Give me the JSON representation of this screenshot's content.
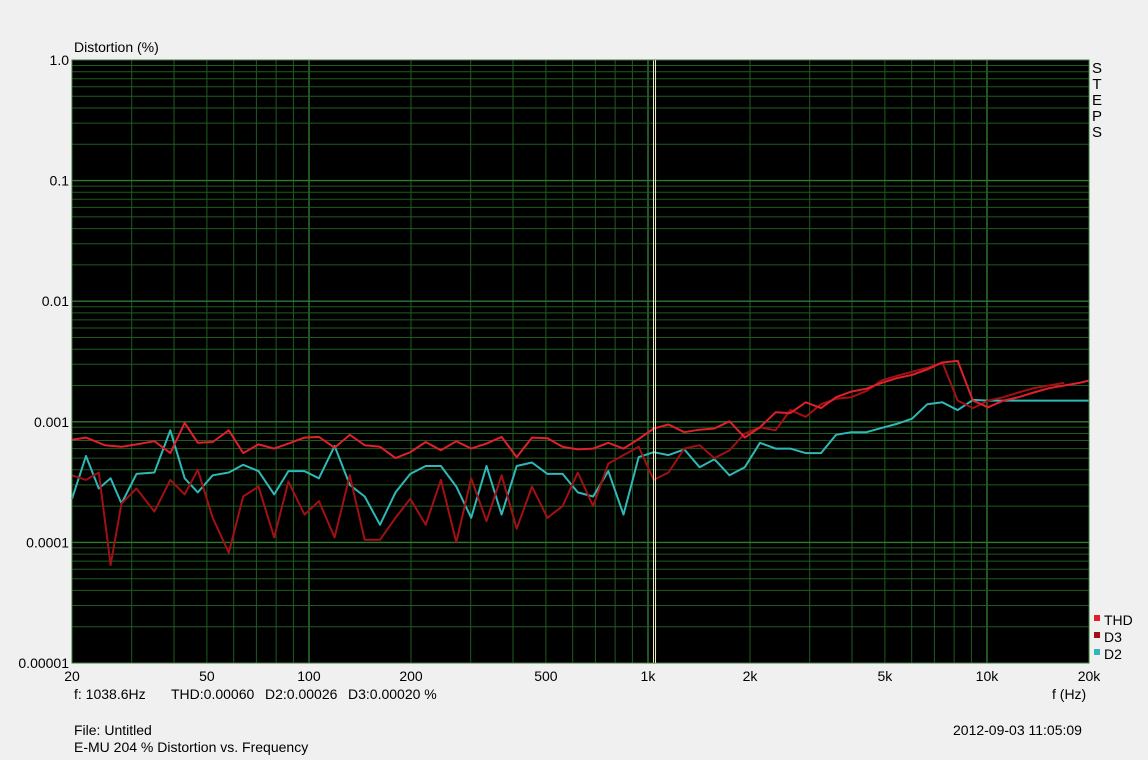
{
  "window": {
    "title": "E-MU 204 % Distortion vs. Frequency"
  },
  "footer": {
    "file_label": "File: Untitled",
    "title": "E-MU 204 % Distortion vs. Frequency",
    "timestamp": "2012-09-03 11:05:09"
  },
  "readout": {
    "freq": "f: 1038.6Hz",
    "thd": "THD:0.00060",
    "d2": "D2:0.00026",
    "d3": "D3:0.00020 %"
  },
  "side_button": {
    "label": "STEPS",
    "letters": [
      "S",
      "T",
      "E",
      "P",
      "S"
    ]
  },
  "colors": {
    "background": "#000000",
    "grid": "#1f5c1f",
    "cursor": "#f0f0c0",
    "thd": "#e0202a",
    "d3": "#a01014",
    "d2": "#2fb8b8"
  },
  "chart_data": {
    "type": "line",
    "title": "",
    "ylabel": "Distortion (%)",
    "xlabel": "f (Hz)",
    "xscale": "log",
    "yscale": "log",
    "xlim": [
      20,
      20000
    ],
    "ylim": [
      1e-05,
      1.0
    ],
    "grid": true,
    "legend_position": "bottom-right",
    "x_tick_labels": [
      "20",
      "50",
      "100",
      "200",
      "500",
      "1k",
      "2k",
      "5k",
      "10k",
      "20k"
    ],
    "x_tick_values": [
      20,
      50,
      100,
      200,
      500,
      1000,
      2000,
      5000,
      10000,
      20000
    ],
    "y_tick_labels": [
      "1.0",
      "0.1",
      "0.01",
      "0.001",
      "0.0001",
      "0.00001"
    ],
    "y_tick_values": [
      1.0,
      0.1,
      0.01,
      0.001,
      0.0001,
      1e-05
    ],
    "cursor_x": 1038.6,
    "series": [
      {
        "name": "THD",
        "color": "#e0202a",
        "x": [
          20,
          22,
          25,
          28,
          31,
          35,
          39,
          43,
          47,
          52,
          58,
          64,
          71,
          79,
          87,
          97,
          107,
          119,
          132,
          146,
          162,
          180,
          199,
          221,
          245,
          272,
          301,
          334,
          370,
          410,
          455,
          505,
          560,
          621,
          689,
          764,
          847,
          939,
          1040,
          1150,
          1280,
          1420,
          1570,
          1740,
          1930,
          2140,
          2380,
          2630,
          2920,
          3240,
          3590,
          3980,
          4410,
          4890,
          5420,
          6010,
          6670,
          7390,
          8200,
          9090,
          10080,
          11180,
          12390,
          13740,
          15240,
          16900,
          18740,
          20000
        ],
        "y": [
          0.00071,
          0.00074,
          0.00064,
          0.00062,
          0.00065,
          0.00069,
          0.00055,
          0.00098,
          0.00067,
          0.00068,
          0.00085,
          0.00055,
          0.00065,
          0.0006,
          0.00066,
          0.00074,
          0.00075,
          0.00061,
          0.00078,
          0.00064,
          0.00062,
          0.0005,
          0.00056,
          0.00068,
          0.00058,
          0.00069,
          0.0006,
          0.00066,
          0.00075,
          0.00051,
          0.00074,
          0.00073,
          0.00062,
          0.00059,
          0.0006,
          0.00067,
          0.0006,
          0.00072,
          0.00088,
          0.00095,
          0.00082,
          0.00086,
          0.00088,
          0.00101,
          0.00074,
          0.0009,
          0.0012,
          0.00118,
          0.00145,
          0.0013,
          0.0016,
          0.00178,
          0.00188,
          0.0021,
          0.0023,
          0.00245,
          0.00272,
          0.0031,
          0.0032,
          0.0015,
          0.00132,
          0.0015,
          0.0016,
          0.00175,
          0.0019,
          0.002,
          0.0021,
          0.0022
        ]
      },
      {
        "name": "D3",
        "color": "#a01014",
        "x": [
          20,
          22,
          24,
          26,
          28,
          31,
          35,
          39,
          43,
          47,
          52,
          58,
          64,
          71,
          79,
          87,
          97,
          107,
          119,
          132,
          146,
          162,
          180,
          199,
          221,
          245,
          272,
          301,
          334,
          370,
          410,
          455,
          505,
          560,
          621,
          689,
          764,
          847,
          939,
          1040,
          1150,
          1280,
          1420,
          1570,
          1740,
          1930,
          2140,
          2380,
          2630,
          2920,
          3240,
          3590,
          3980,
          4410,
          4890,
          5420,
          6010,
          6670,
          7390,
          8200,
          9090,
          10080,
          11180,
          12390,
          13740,
          15240,
          16900
        ],
        "y": [
          0.00036,
          0.00033,
          0.00038,
          6.5e-05,
          0.00021,
          0.00028,
          0.00018,
          0.00033,
          0.00025,
          0.0004,
          0.00016,
          8.2e-05,
          0.00024,
          0.00029,
          0.00011,
          0.00032,
          0.00017,
          0.00022,
          0.00011,
          0.00036,
          0.000105,
          0.000105,
          0.00016,
          0.00023,
          0.00014,
          0.00033,
          0.0001,
          0.00034,
          0.00015,
          0.00036,
          0.00013,
          0.00029,
          0.00016,
          0.0002,
          0.00038,
          0.0002,
          0.00045,
          0.00053,
          0.00062,
          0.00033,
          0.00038,
          0.0006,
          0.00064,
          0.0005,
          0.00058,
          0.0008,
          0.0009,
          0.00085,
          0.00125,
          0.0011,
          0.0014,
          0.00155,
          0.0016,
          0.0018,
          0.0022,
          0.0024,
          0.0026,
          0.0028,
          0.0031,
          0.0015,
          0.0013,
          0.0015,
          0.0016,
          0.00175,
          0.0019,
          0.002,
          0.0021
        ]
      },
      {
        "name": "D2",
        "color": "#2fb8b8",
        "x": [
          20,
          22,
          24,
          26,
          28,
          31,
          35,
          39,
          43,
          47,
          52,
          58,
          64,
          71,
          79,
          87,
          97,
          107,
          119,
          132,
          146,
          162,
          180,
          199,
          221,
          245,
          272,
          301,
          334,
          370,
          410,
          455,
          505,
          560,
          621,
          689,
          764,
          847,
          939,
          1040,
          1150,
          1280,
          1420,
          1570,
          1740,
          1930,
          2140,
          2380,
          2630,
          2920,
          3240,
          3590,
          3980,
          4410,
          4890,
          5420,
          6010,
          6670,
          7390,
          8200,
          9090,
          10080,
          11180,
          12390,
          13740,
          15240,
          16900,
          18740,
          20000
        ],
        "y": [
          0.00023,
          0.00052,
          0.00028,
          0.00034,
          0.00021,
          0.00037,
          0.00038,
          0.00085,
          0.00034,
          0.00026,
          0.00036,
          0.00038,
          0.00044,
          0.00039,
          0.00025,
          0.00039,
          0.00039,
          0.00034,
          0.00063,
          0.0003,
          0.00024,
          0.00014,
          0.00026,
          0.00037,
          0.00043,
          0.00043,
          0.00029,
          0.00016,
          0.00043,
          0.00017,
          0.00043,
          0.00046,
          0.00037,
          0.00037,
          0.00026,
          0.00024,
          0.00039,
          0.00017,
          0.00051,
          0.00056,
          0.00053,
          0.00059,
          0.00042,
          0.00049,
          0.00036,
          0.00042,
          0.00067,
          0.0006,
          0.0006,
          0.00055,
          0.00055,
          0.00078,
          0.00082,
          0.00082,
          0.00089,
          0.00096,
          0.00106,
          0.0014,
          0.00145,
          0.00125,
          0.00152,
          0.0015,
          0.0015,
          0.0015,
          0.0015,
          0.0015,
          0.0015,
          0.0015,
          0.0015
        ]
      }
    ]
  }
}
